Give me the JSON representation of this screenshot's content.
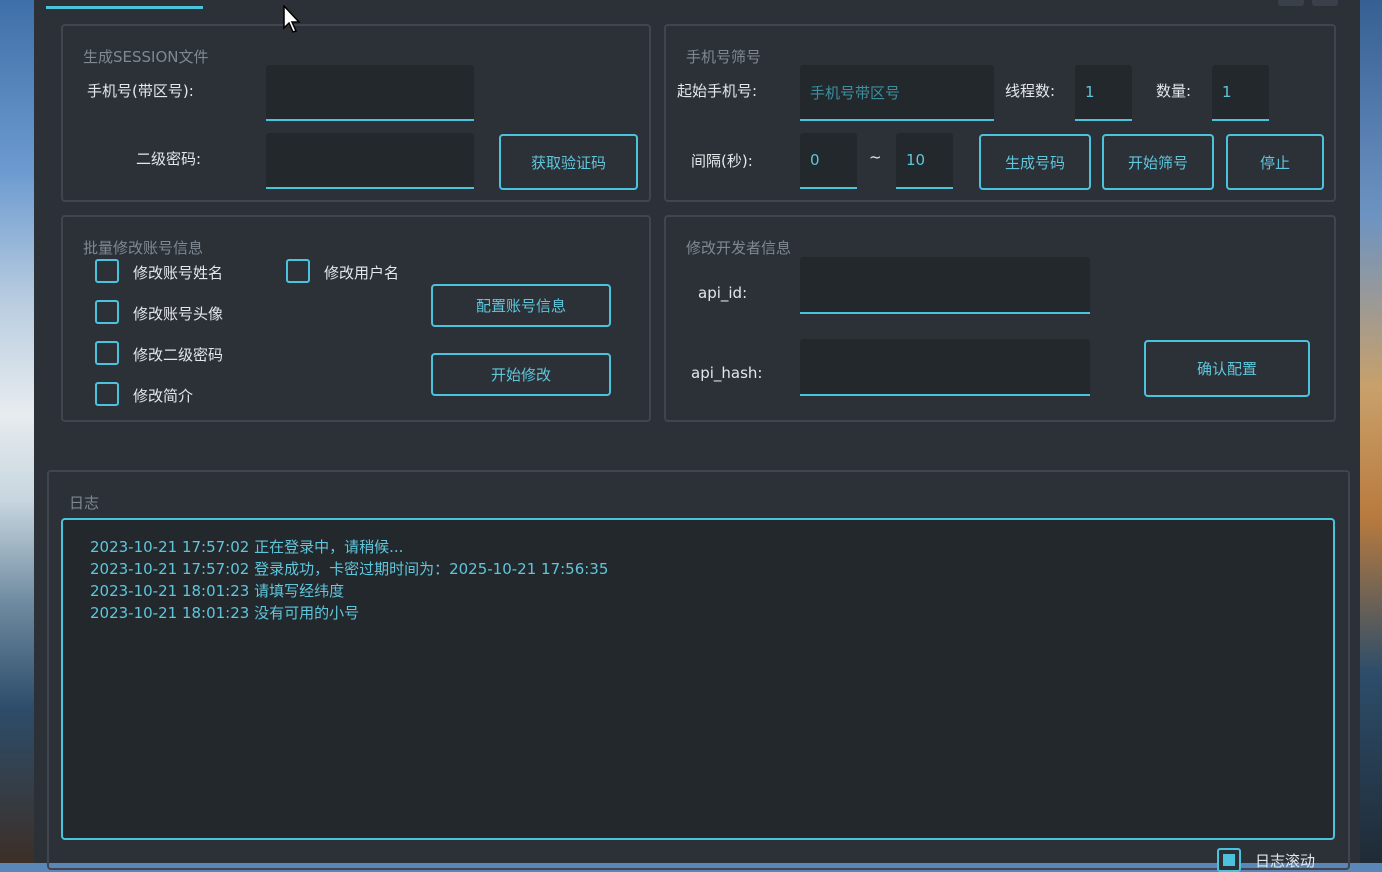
{
  "session_group": {
    "title": "生成SESSION文件",
    "phone_label": "手机号(带区号):",
    "phone_value": "",
    "password_label": "二级密码:",
    "password_value": "",
    "get_code_button": "获取验证码"
  },
  "filter_group": {
    "title": "手机号筛号",
    "start_phone_label": "起始手机号:",
    "start_phone_placeholder": "手机号带区号",
    "threads_label": "线程数:",
    "threads_value": "1",
    "count_label": "数量:",
    "count_value": "1",
    "interval_label": "间隔(秒):",
    "interval_min": "0",
    "interval_sep": "~",
    "interval_max": "10",
    "generate_button": "生成号码",
    "start_filter_button": "开始筛号",
    "stop_button": "停止"
  },
  "batch_group": {
    "title": "批量修改账号信息",
    "checkboxes": [
      {
        "label": "修改账号姓名",
        "checked": false
      },
      {
        "label": "修改用户名",
        "checked": false
      },
      {
        "label": "修改账号头像",
        "checked": false
      },
      {
        "label": "修改二级密码",
        "checked": false
      },
      {
        "label": "修改简介",
        "checked": false
      }
    ],
    "config_button": "配置账号信息",
    "start_button": "开始修改"
  },
  "dev_group": {
    "title": "修改开发者信息",
    "api_id_label": "api_id:",
    "api_id_value": "",
    "api_hash_label": "api_hash:",
    "api_hash_value": "",
    "confirm_button": "确认配置"
  },
  "log_group": {
    "title": "日志",
    "lines": [
      "2023-10-21 17:57:02 正在登录中，请稍候...",
      "2023-10-21 17:57:02 登录成功，卡密过期时间为：2025-10-21 17:56:35",
      "2023-10-21 18:01:23 请填写经纬度",
      "2023-10-21 18:01:23 没有可用的小号"
    ],
    "scroll_checkbox_label": "日志滚动",
    "scroll_checked": true
  },
  "colors": {
    "accent": "#4cc3dd",
    "background": "#2c3138",
    "field": "#23282d"
  }
}
